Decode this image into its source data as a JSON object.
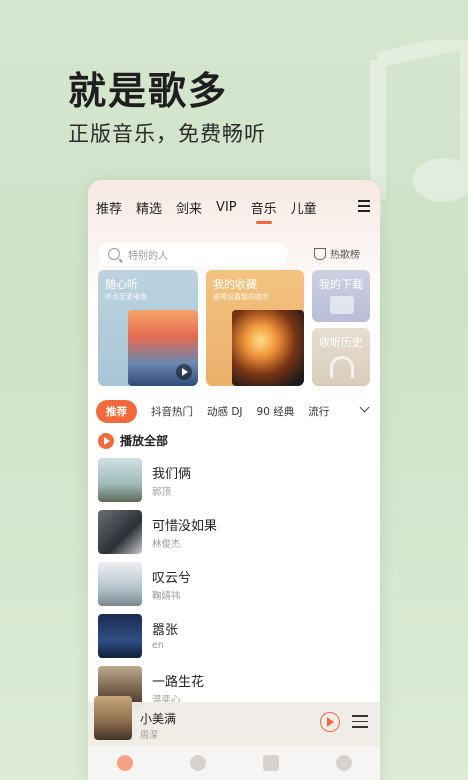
{
  "hero": {
    "title": "就是歌多",
    "subtitle": "正版音乐，免费畅听"
  },
  "tabs": [
    "推荐",
    "精选",
    "剑来",
    "VIP",
    "音乐",
    "儿童"
  ],
  "active_tab_index": 4,
  "search": {
    "placeholder": "特别的人",
    "hot_label": "热歌榜"
  },
  "cards": {
    "random": {
      "title": "随心听",
      "subtitle": "听点至爱电南"
    },
    "favorites": {
      "title": "我的收藏",
      "subtitle": "提得设置我的收听"
    },
    "downloads": {
      "title": "我的下载"
    },
    "history": {
      "title": "收听历史"
    }
  },
  "genres": [
    "推荐",
    "抖音热门",
    "动感 DJ",
    "90 经典",
    "流行"
  ],
  "play_all_label": "播放全部",
  "songs": [
    {
      "title": "我们俩",
      "artist": "郭顶"
    },
    {
      "title": "可惜没如果",
      "artist": "林俊杰"
    },
    {
      "title": "叹云兮",
      "artist": "鞠婧祎"
    },
    {
      "title": "嚣张",
      "artist": "en"
    },
    {
      "title": "一路生花",
      "artist": "温奕心"
    }
  ],
  "player": {
    "title": "小美满",
    "artist": "周深"
  },
  "colors": {
    "accent": "#f06a3b",
    "background": "#d5e6cf"
  }
}
